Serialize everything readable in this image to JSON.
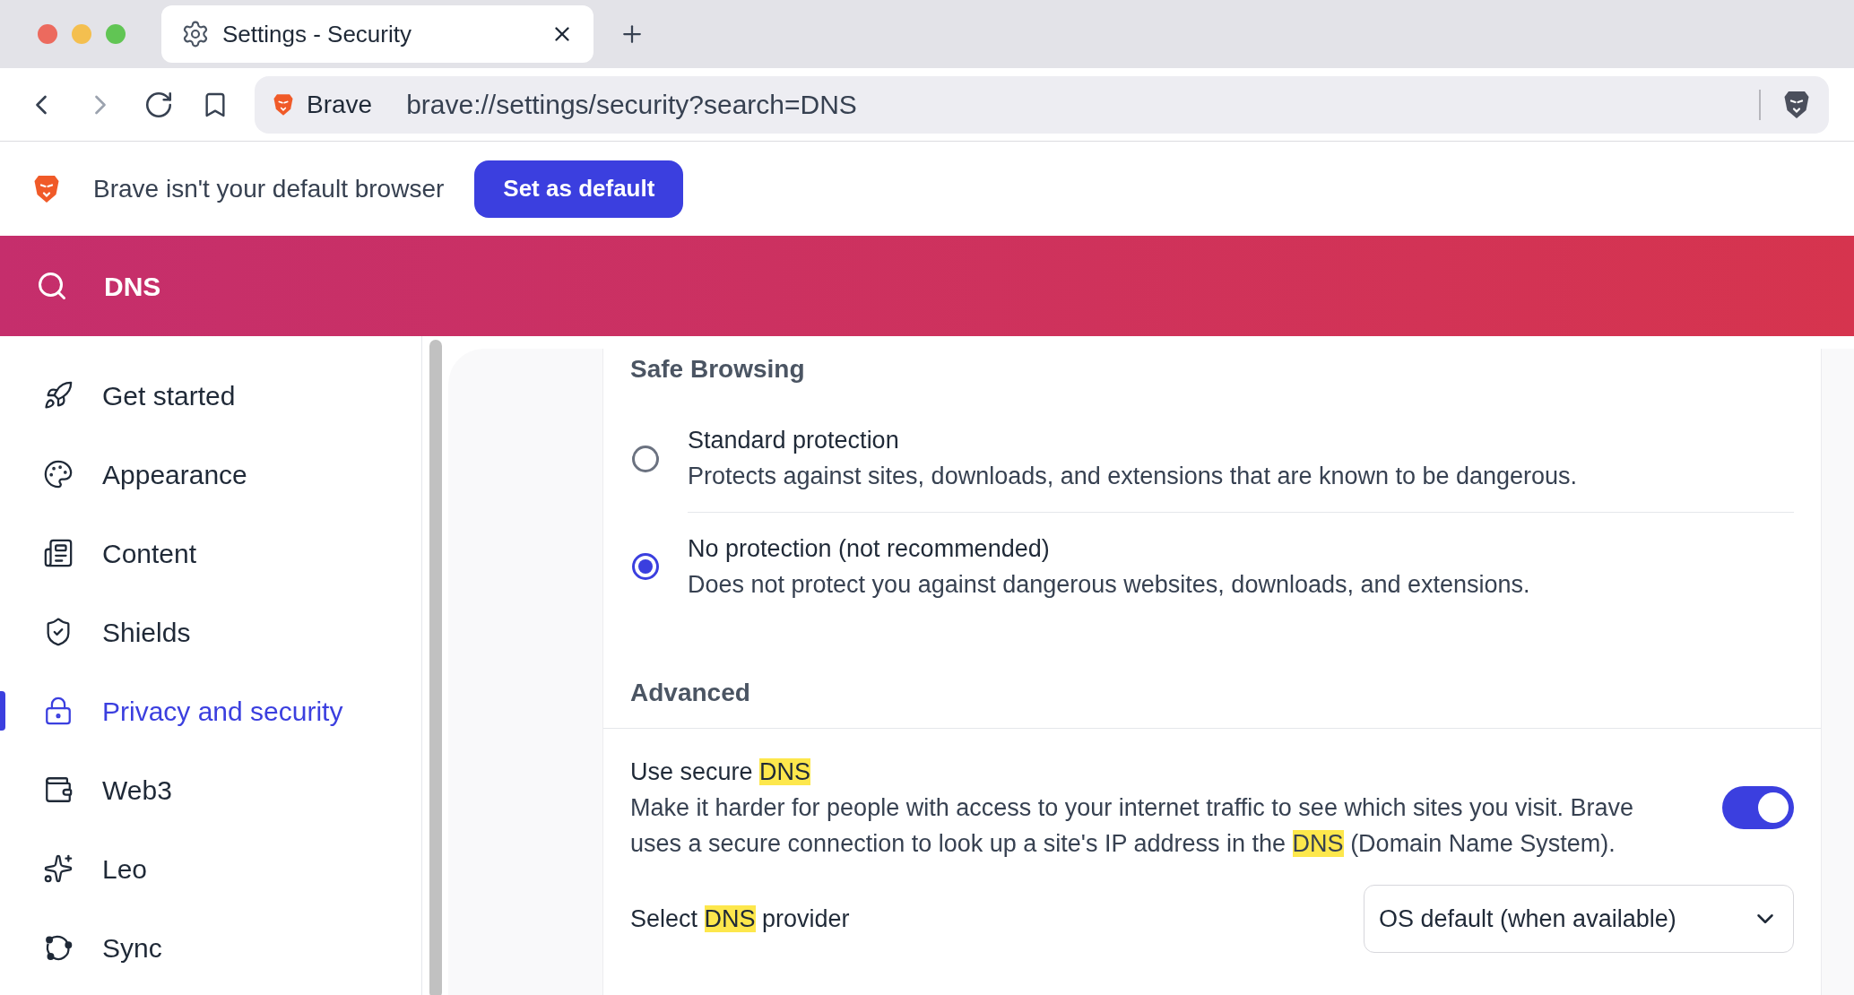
{
  "tabs": [
    {
      "title": "Settings - Security",
      "selected": true
    }
  ],
  "toolbar": {
    "site_label": "Brave",
    "url": "brave://settings/security?search=DNS"
  },
  "banner": {
    "message": "Brave isn't your default browser",
    "button": "Set as default"
  },
  "search": {
    "value": "DNS"
  },
  "sidebar": {
    "items": [
      {
        "label": "Get started",
        "selected": false
      },
      {
        "label": "Appearance",
        "selected": false
      },
      {
        "label": "Content",
        "selected": false
      },
      {
        "label": "Shields",
        "selected": false
      },
      {
        "label": "Privacy and security",
        "selected": true
      },
      {
        "label": "Web3",
        "selected": false
      },
      {
        "label": "Leo",
        "selected": false
      },
      {
        "label": "Sync",
        "selected": false
      }
    ]
  },
  "safe_browsing": {
    "title": "Safe Browsing",
    "options": [
      {
        "title": "Standard protection",
        "description": "Protects against sites, downloads, and extensions that are known to be dangerous.",
        "selected": false
      },
      {
        "title": "No protection (not recommended)",
        "description": "Does not protect you against dangerous websites, downloads, and extensions.",
        "selected": true
      }
    ]
  },
  "advanced": {
    "title": "Advanced",
    "secure_dns": {
      "label": [
        {
          "text": "Use secure "
        },
        {
          "text": "DNS",
          "highlighted": true
        }
      ],
      "description": [
        {
          "text": "Make it harder for people with access to your internet traffic to see which sites you visit. Brave uses a secure connection to look up a site's IP address in the "
        },
        {
          "text": "DNS",
          "highlighted": true
        },
        {
          "text": " (Domain Name System)."
        }
      ],
      "on": true
    },
    "provider": {
      "label": [
        {
          "text": "Select "
        },
        {
          "text": "DNS",
          "highlighted": true
        },
        {
          "text": " provider"
        }
      ],
      "value": "OS default (when available)"
    }
  }
}
